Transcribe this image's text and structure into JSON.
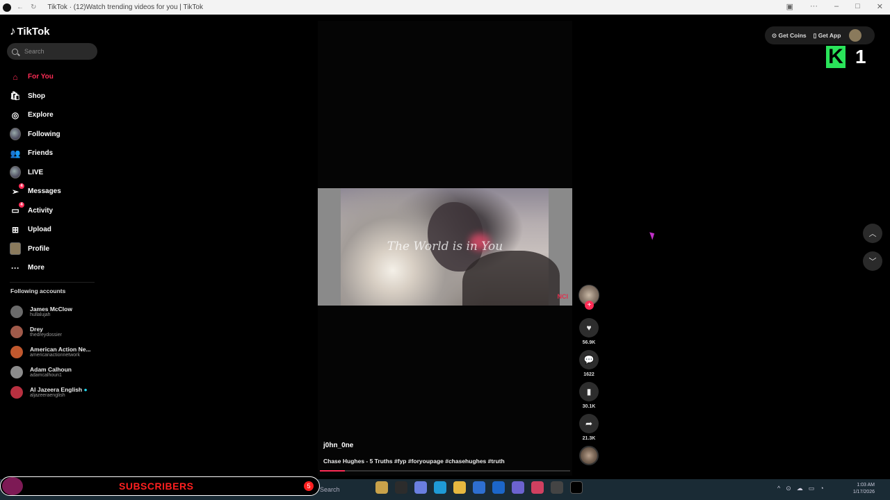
{
  "browser": {
    "tab_title": "TikTok · (12)Watch trending videos for you | TikTok"
  },
  "sidebar": {
    "logo": "TikTok",
    "search_placeholder": "Search",
    "menu": [
      {
        "label": "For You",
        "icon": "home-icon",
        "active": true
      },
      {
        "label": "Shop",
        "icon": "shop-bag-icon"
      },
      {
        "label": "Explore",
        "icon": "compass-icon"
      },
      {
        "label": "Following",
        "icon": "following-avatar-icon"
      },
      {
        "label": "Friends",
        "icon": "friends-icon"
      },
      {
        "label": "LIVE",
        "icon": "live-avatar-icon"
      },
      {
        "label": "Messages",
        "icon": "paper-plane-icon",
        "badge": "4"
      },
      {
        "label": "Activity",
        "icon": "activity-icon",
        "badge": "4"
      },
      {
        "label": "Upload",
        "icon": "plus-square-icon"
      },
      {
        "label": "Profile",
        "icon": "profile-avatar-icon"
      },
      {
        "label": "More",
        "icon": "ellipsis-icon"
      }
    ],
    "following_title": "Following accounts",
    "accounts": [
      {
        "name": "James McClow",
        "handle": "hullalujah"
      },
      {
        "name": "Drey",
        "handle": "thedreydossier"
      },
      {
        "name": "American Action Ne...",
        "handle": "americanactionnetwork"
      },
      {
        "name": "Adam Calhoun",
        "handle": "adamcalhoun1"
      },
      {
        "name": "Al Jazeera English",
        "handle": "aljazeeraenglish",
        "verified": true
      }
    ]
  },
  "video": {
    "overlay_text": "The World is in You",
    "corner_tag": "NCI",
    "username": "j0hn_0ne",
    "description": "Chase Hughes - 5 Truths #fyp #foryoupage #chasehughes #truth",
    "progress_fraction": 0.1,
    "likes": "56.9K",
    "comments": "1622",
    "saves": "30.1K",
    "shares": "21.3K"
  },
  "header": {
    "get_coins": "Get Coins",
    "get_app": "Get App"
  },
  "watermark": {
    "letter": "K",
    "number": "1"
  },
  "banner": {
    "text": "SUBSCRIBERS",
    "badge": "5"
  },
  "taskbar": {
    "search": "Search",
    "time": "1:03 AM",
    "date": "1/17/2026"
  },
  "colors": {
    "accent": "#fe2c55",
    "watermark_green": "#2ae35a",
    "banner_red": "#ff1f1f"
  }
}
